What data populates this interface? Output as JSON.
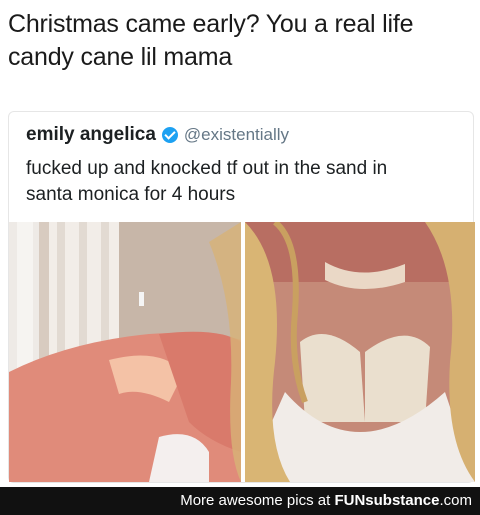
{
  "post": {
    "caption_line1": "Christmas came early? You a real life",
    "caption_line2": "candy cane lil mama"
  },
  "tweet": {
    "name": "emily angelica",
    "handle": "@existentially",
    "text_line1": "fucked up and knocked tf out in the sand in",
    "text_line2": "santa monica for 4 hours",
    "verified_color": "#1da1f2"
  },
  "footer": {
    "prefix": "More awesome pics at ",
    "brand": "FUNsubstance",
    "domain": ".com"
  }
}
